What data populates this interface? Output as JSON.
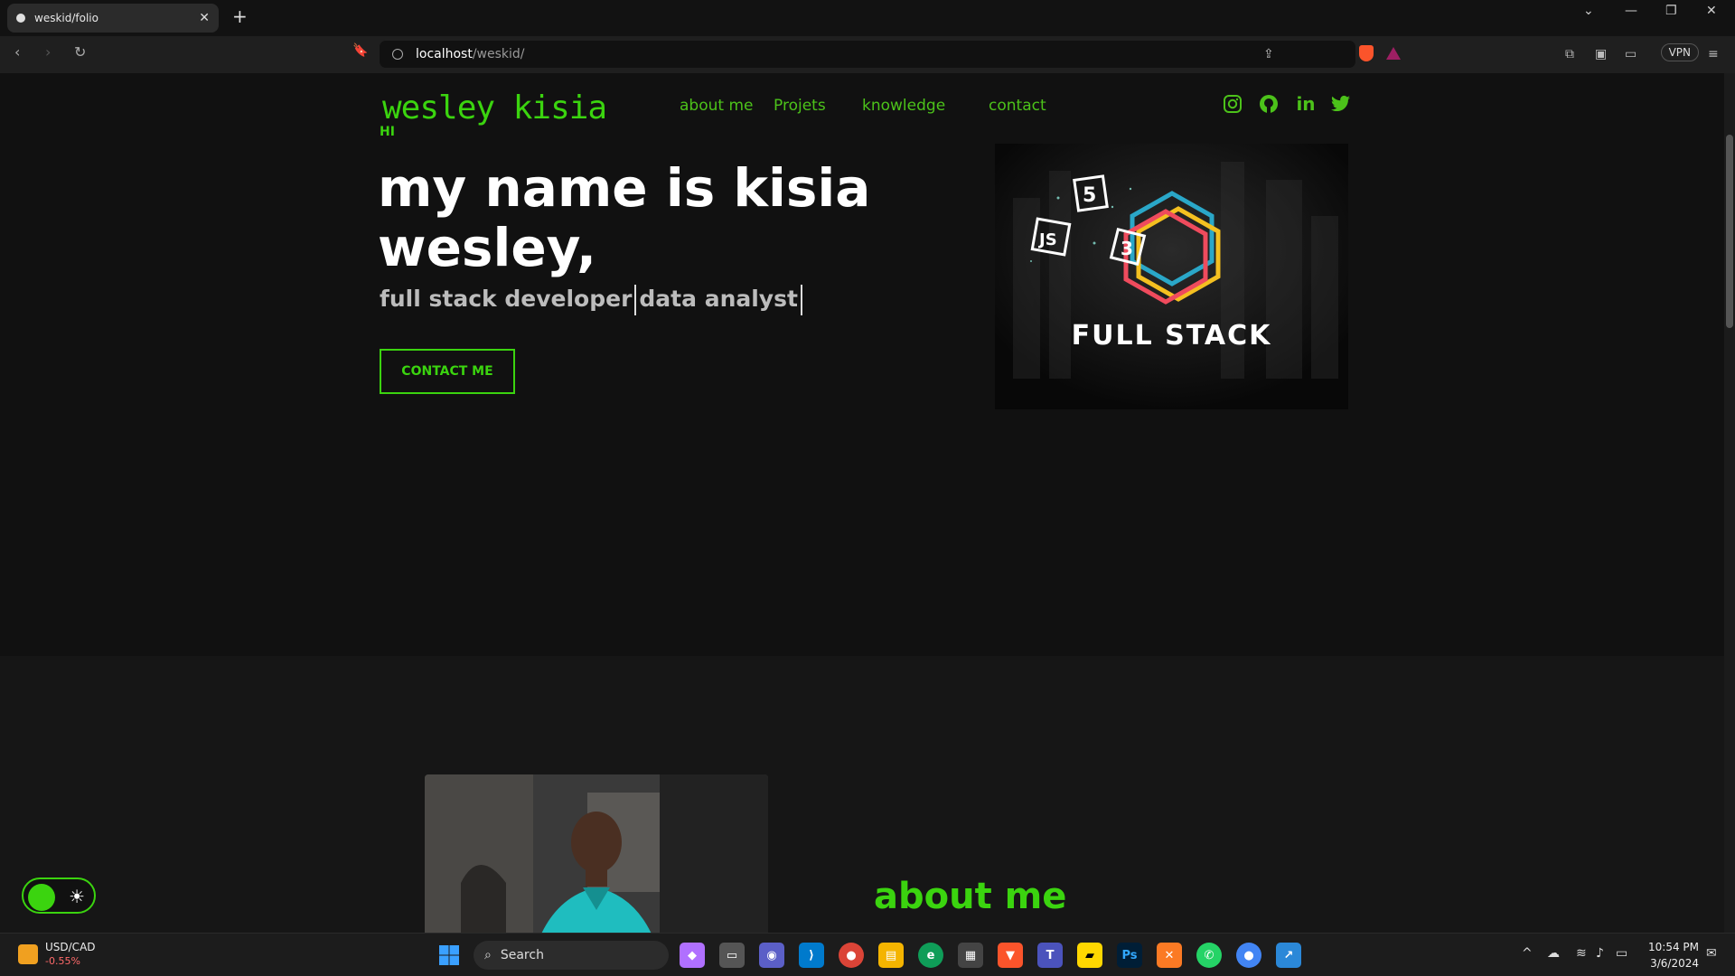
{
  "browser": {
    "tab_title": "weskid/folio",
    "url_host": "localhost",
    "url_path": "/weskid/",
    "vpn_label": "VPN"
  },
  "site": {
    "logo": "wesley kisia",
    "nav": [
      "about me",
      "Projets",
      "knowledge",
      "contact"
    ],
    "social": [
      "instagram-icon",
      "github-icon",
      "linkedin-icon",
      "twitter-icon"
    ],
    "greeting": "HI",
    "headline": "my name is kisia wesley,",
    "role_1": "full stack developer",
    "role_2": "data analyst",
    "contact_button": "CONTACT ME",
    "card_caption": "FULL STACK",
    "about_title": "about me",
    "accent": "#3bd40f"
  },
  "taskbar": {
    "ticker_name": "USD/CAD",
    "ticker_change": "-0.55%",
    "search_placeholder": "Search",
    "time": "10:54 PM",
    "date": "3/6/2024"
  }
}
